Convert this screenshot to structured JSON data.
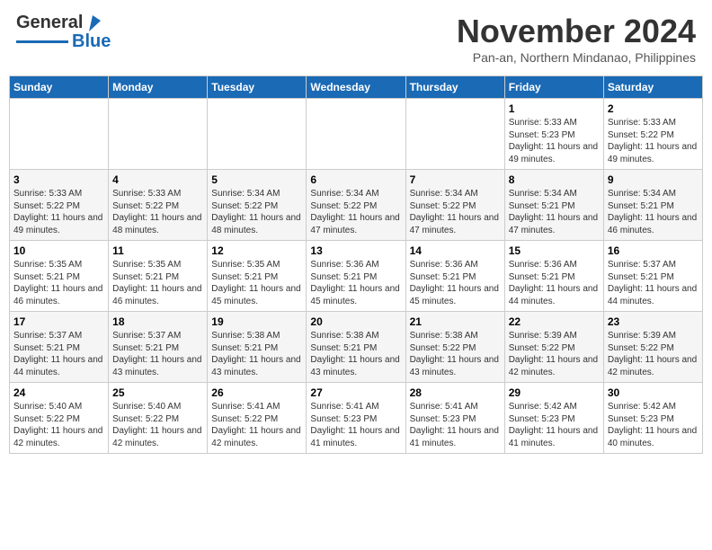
{
  "header": {
    "logo_line1": "General",
    "logo_line2": "Blue",
    "month_title": "November 2024",
    "location": "Pan-an, Northern Mindanao, Philippines"
  },
  "weekdays": [
    "Sunday",
    "Monday",
    "Tuesday",
    "Wednesday",
    "Thursday",
    "Friday",
    "Saturday"
  ],
  "weeks": [
    [
      {
        "day": "",
        "sunrise": "",
        "sunset": "",
        "daylight": ""
      },
      {
        "day": "",
        "sunrise": "",
        "sunset": "",
        "daylight": ""
      },
      {
        "day": "",
        "sunrise": "",
        "sunset": "",
        "daylight": ""
      },
      {
        "day": "",
        "sunrise": "",
        "sunset": "",
        "daylight": ""
      },
      {
        "day": "",
        "sunrise": "",
        "sunset": "",
        "daylight": ""
      },
      {
        "day": "1",
        "sunrise": "Sunrise: 5:33 AM",
        "sunset": "Sunset: 5:23 PM",
        "daylight": "Daylight: 11 hours and 49 minutes."
      },
      {
        "day": "2",
        "sunrise": "Sunrise: 5:33 AM",
        "sunset": "Sunset: 5:22 PM",
        "daylight": "Daylight: 11 hours and 49 minutes."
      }
    ],
    [
      {
        "day": "3",
        "sunrise": "Sunrise: 5:33 AM",
        "sunset": "Sunset: 5:22 PM",
        "daylight": "Daylight: 11 hours and 49 minutes."
      },
      {
        "day": "4",
        "sunrise": "Sunrise: 5:33 AM",
        "sunset": "Sunset: 5:22 PM",
        "daylight": "Daylight: 11 hours and 48 minutes."
      },
      {
        "day": "5",
        "sunrise": "Sunrise: 5:34 AM",
        "sunset": "Sunset: 5:22 PM",
        "daylight": "Daylight: 11 hours and 48 minutes."
      },
      {
        "day": "6",
        "sunrise": "Sunrise: 5:34 AM",
        "sunset": "Sunset: 5:22 PM",
        "daylight": "Daylight: 11 hours and 47 minutes."
      },
      {
        "day": "7",
        "sunrise": "Sunrise: 5:34 AM",
        "sunset": "Sunset: 5:22 PM",
        "daylight": "Daylight: 11 hours and 47 minutes."
      },
      {
        "day": "8",
        "sunrise": "Sunrise: 5:34 AM",
        "sunset": "Sunset: 5:21 PM",
        "daylight": "Daylight: 11 hours and 47 minutes."
      },
      {
        "day": "9",
        "sunrise": "Sunrise: 5:34 AM",
        "sunset": "Sunset: 5:21 PM",
        "daylight": "Daylight: 11 hours and 46 minutes."
      }
    ],
    [
      {
        "day": "10",
        "sunrise": "Sunrise: 5:35 AM",
        "sunset": "Sunset: 5:21 PM",
        "daylight": "Daylight: 11 hours and 46 minutes."
      },
      {
        "day": "11",
        "sunrise": "Sunrise: 5:35 AM",
        "sunset": "Sunset: 5:21 PM",
        "daylight": "Daylight: 11 hours and 46 minutes."
      },
      {
        "day": "12",
        "sunrise": "Sunrise: 5:35 AM",
        "sunset": "Sunset: 5:21 PM",
        "daylight": "Daylight: 11 hours and 45 minutes."
      },
      {
        "day": "13",
        "sunrise": "Sunrise: 5:36 AM",
        "sunset": "Sunset: 5:21 PM",
        "daylight": "Daylight: 11 hours and 45 minutes."
      },
      {
        "day": "14",
        "sunrise": "Sunrise: 5:36 AM",
        "sunset": "Sunset: 5:21 PM",
        "daylight": "Daylight: 11 hours and 45 minutes."
      },
      {
        "day": "15",
        "sunrise": "Sunrise: 5:36 AM",
        "sunset": "Sunset: 5:21 PM",
        "daylight": "Daylight: 11 hours and 44 minutes."
      },
      {
        "day": "16",
        "sunrise": "Sunrise: 5:37 AM",
        "sunset": "Sunset: 5:21 PM",
        "daylight": "Daylight: 11 hours and 44 minutes."
      }
    ],
    [
      {
        "day": "17",
        "sunrise": "Sunrise: 5:37 AM",
        "sunset": "Sunset: 5:21 PM",
        "daylight": "Daylight: 11 hours and 44 minutes."
      },
      {
        "day": "18",
        "sunrise": "Sunrise: 5:37 AM",
        "sunset": "Sunset: 5:21 PM",
        "daylight": "Daylight: 11 hours and 43 minutes."
      },
      {
        "day": "19",
        "sunrise": "Sunrise: 5:38 AM",
        "sunset": "Sunset: 5:21 PM",
        "daylight": "Daylight: 11 hours and 43 minutes."
      },
      {
        "day": "20",
        "sunrise": "Sunrise: 5:38 AM",
        "sunset": "Sunset: 5:21 PM",
        "daylight": "Daylight: 11 hours and 43 minutes."
      },
      {
        "day": "21",
        "sunrise": "Sunrise: 5:38 AM",
        "sunset": "Sunset: 5:22 PM",
        "daylight": "Daylight: 11 hours and 43 minutes."
      },
      {
        "day": "22",
        "sunrise": "Sunrise: 5:39 AM",
        "sunset": "Sunset: 5:22 PM",
        "daylight": "Daylight: 11 hours and 42 minutes."
      },
      {
        "day": "23",
        "sunrise": "Sunrise: 5:39 AM",
        "sunset": "Sunset: 5:22 PM",
        "daylight": "Daylight: 11 hours and 42 minutes."
      }
    ],
    [
      {
        "day": "24",
        "sunrise": "Sunrise: 5:40 AM",
        "sunset": "Sunset: 5:22 PM",
        "daylight": "Daylight: 11 hours and 42 minutes."
      },
      {
        "day": "25",
        "sunrise": "Sunrise: 5:40 AM",
        "sunset": "Sunset: 5:22 PM",
        "daylight": "Daylight: 11 hours and 42 minutes."
      },
      {
        "day": "26",
        "sunrise": "Sunrise: 5:41 AM",
        "sunset": "Sunset: 5:22 PM",
        "daylight": "Daylight: 11 hours and 42 minutes."
      },
      {
        "day": "27",
        "sunrise": "Sunrise: 5:41 AM",
        "sunset": "Sunset: 5:23 PM",
        "daylight": "Daylight: 11 hours and 41 minutes."
      },
      {
        "day": "28",
        "sunrise": "Sunrise: 5:41 AM",
        "sunset": "Sunset: 5:23 PM",
        "daylight": "Daylight: 11 hours and 41 minutes."
      },
      {
        "day": "29",
        "sunrise": "Sunrise: 5:42 AM",
        "sunset": "Sunset: 5:23 PM",
        "daylight": "Daylight: 11 hours and 41 minutes."
      },
      {
        "day": "30",
        "sunrise": "Sunrise: 5:42 AM",
        "sunset": "Sunset: 5:23 PM",
        "daylight": "Daylight: 11 hours and 40 minutes."
      }
    ]
  ]
}
